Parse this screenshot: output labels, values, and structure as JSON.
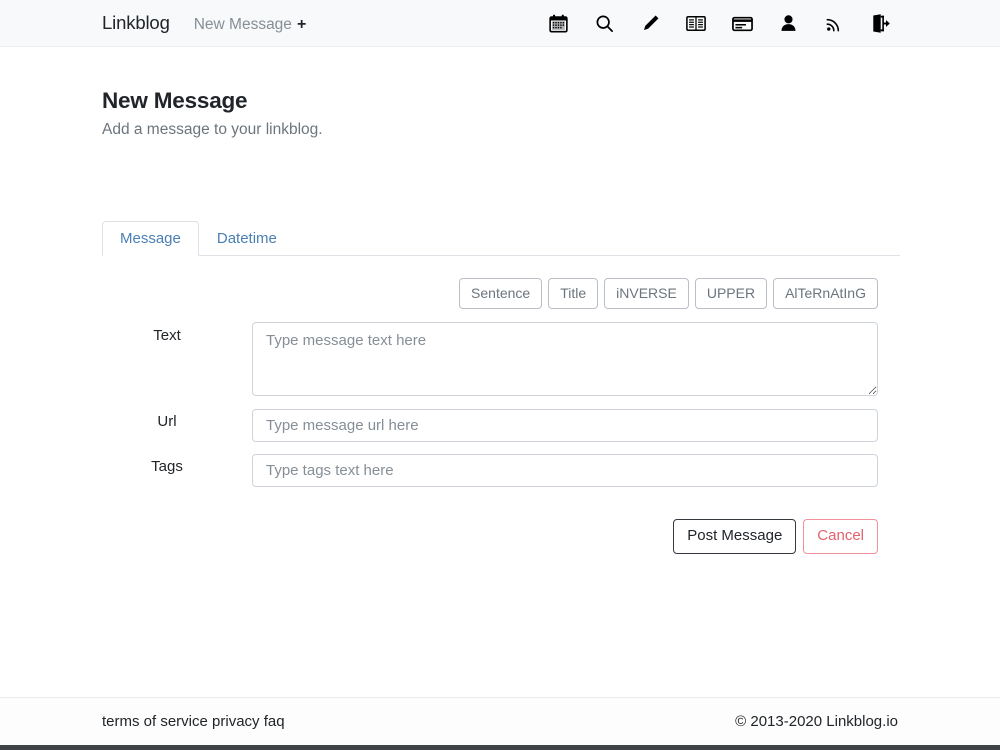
{
  "navbar": {
    "brand": "Linkblog",
    "new_message_link": "New Message",
    "new_message_plus": "+",
    "icons": [
      {
        "name": "calendar-icon",
        "title": "calendar"
      },
      {
        "name": "search-icon",
        "title": "search"
      },
      {
        "name": "pencil-icon",
        "title": "edit"
      },
      {
        "name": "book-icon",
        "title": "read"
      },
      {
        "name": "card-icon",
        "title": "card"
      },
      {
        "name": "user-icon",
        "title": "profile"
      },
      {
        "name": "rss-icon",
        "title": "feed"
      },
      {
        "name": "sign-out-icon",
        "title": "sign out"
      }
    ]
  },
  "heading": {
    "title": "New Message",
    "subtitle": "Add a message to your linkblog."
  },
  "tabs": [
    {
      "label": "Message",
      "active": true
    },
    {
      "label": "Datetime",
      "active": false
    }
  ],
  "case_buttons": [
    {
      "label": "Sentence"
    },
    {
      "label": "Title"
    },
    {
      "label": "iNVERSE"
    },
    {
      "label": "UPPER"
    },
    {
      "label": "AlTeRnAtInG"
    }
  ],
  "form": {
    "text": {
      "label": "Text",
      "placeholder": "Type message text here",
      "value": ""
    },
    "url": {
      "label": "Url",
      "placeholder": "Type message url here",
      "value": ""
    },
    "tags": {
      "label": "Tags",
      "placeholder": "Type tags text here",
      "value": ""
    }
  },
  "actions": {
    "submit": "Post Message",
    "cancel": "Cancel"
  },
  "footer": {
    "terms": "terms of service",
    "privacy": "privacy",
    "faq": "faq",
    "copyright": "© 2013-2020 Linkblog.io"
  },
  "colors": {
    "navbar_bg": "#f8f9fa",
    "tab_link": "#4a80b4",
    "danger": "#e4606d",
    "muted": "#868e96",
    "border": "#ced4da",
    "bottom_bar": "#3f4246"
  }
}
